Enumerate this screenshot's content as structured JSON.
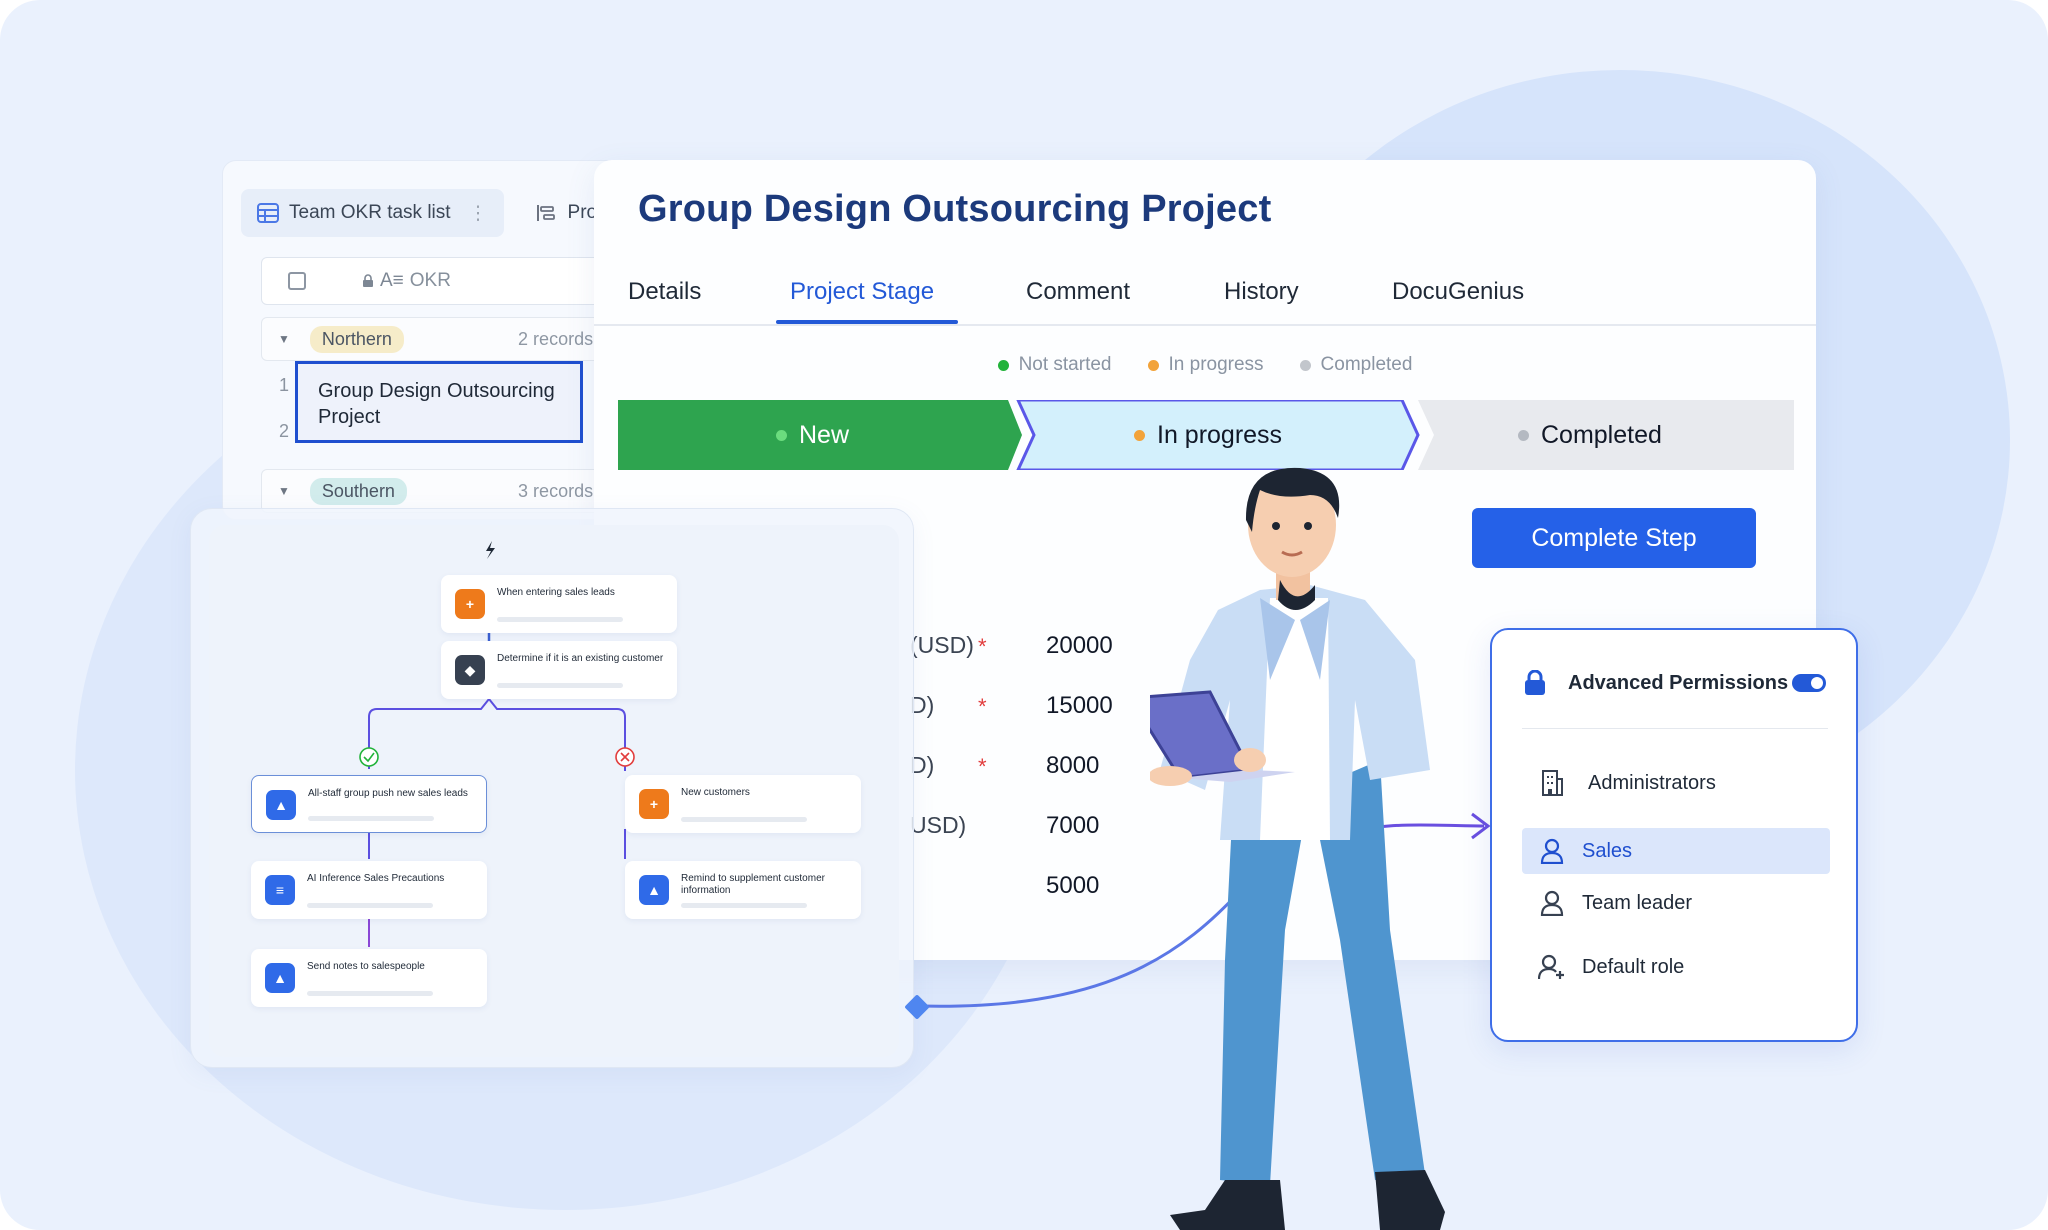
{
  "okr_panel": {
    "tabs": [
      "Team OKR task list",
      "Pro"
    ],
    "column_header": "OKR",
    "groups": [
      {
        "name": "Northern",
        "count": "2 records",
        "color": "#f6ecc9"
      },
      {
        "name": "Southern",
        "count": "3 records",
        "color": "#d2ecec"
      }
    ],
    "row_numbers": [
      "1",
      "2"
    ],
    "selected_cell": "Group Design Outsourcing Project"
  },
  "record": {
    "title": "Group Design Outsourcing Project",
    "tabs": [
      "Details",
      "Project Stage",
      "Comment",
      "History",
      "DocuGenius"
    ],
    "active_tab": "Project Stage",
    "legend": [
      {
        "label": "Not started",
        "color": "#22b33a"
      },
      {
        "label": "In progress",
        "color": "#f2a33a"
      },
      {
        "label": "Completed",
        "color": "#c2c6cc"
      }
    ],
    "stages": [
      {
        "label": "New",
        "state": "done"
      },
      {
        "label": "In progress",
        "state": "current"
      },
      {
        "label": "Completed",
        "state": "todo"
      }
    ],
    "complete_button": "Complete Step",
    "fields": [
      {
        "label": "(USD)",
        "required": true,
        "value": "20000"
      },
      {
        "label": "D)",
        "required": true,
        "value": "15000"
      },
      {
        "label": "D)",
        "required": true,
        "value": "8000"
      },
      {
        "label": "USD)",
        "required": false,
        "value": "7000"
      },
      {
        "label": "",
        "required": false,
        "value": "5000"
      }
    ]
  },
  "workflow": {
    "trigger": "When entering sales leads",
    "condition": "Determine if it is an existing customer",
    "yes_branch": [
      "All-staff group push new sales leads",
      "AI Inference Sales Precautions",
      "Send notes to salespeople"
    ],
    "no_branch": [
      "New customers",
      "Remind to supplement customer information"
    ]
  },
  "permissions": {
    "title": "Advanced Permissions",
    "enabled": true,
    "roles": [
      {
        "label": "Administrators",
        "icon": "building-icon",
        "active": false
      },
      {
        "label": "Sales",
        "icon": "user-icon",
        "active": true
      },
      {
        "label": "Team leader",
        "icon": "user-icon",
        "active": false
      },
      {
        "label": "Default role",
        "icon": "user-add-icon",
        "active": false
      }
    ]
  },
  "colors": {
    "primary": "#2359d7",
    "stage_done": "#2ea44f",
    "stage_current": "#d3f0fc",
    "stage_todo": "#e8eaee"
  }
}
